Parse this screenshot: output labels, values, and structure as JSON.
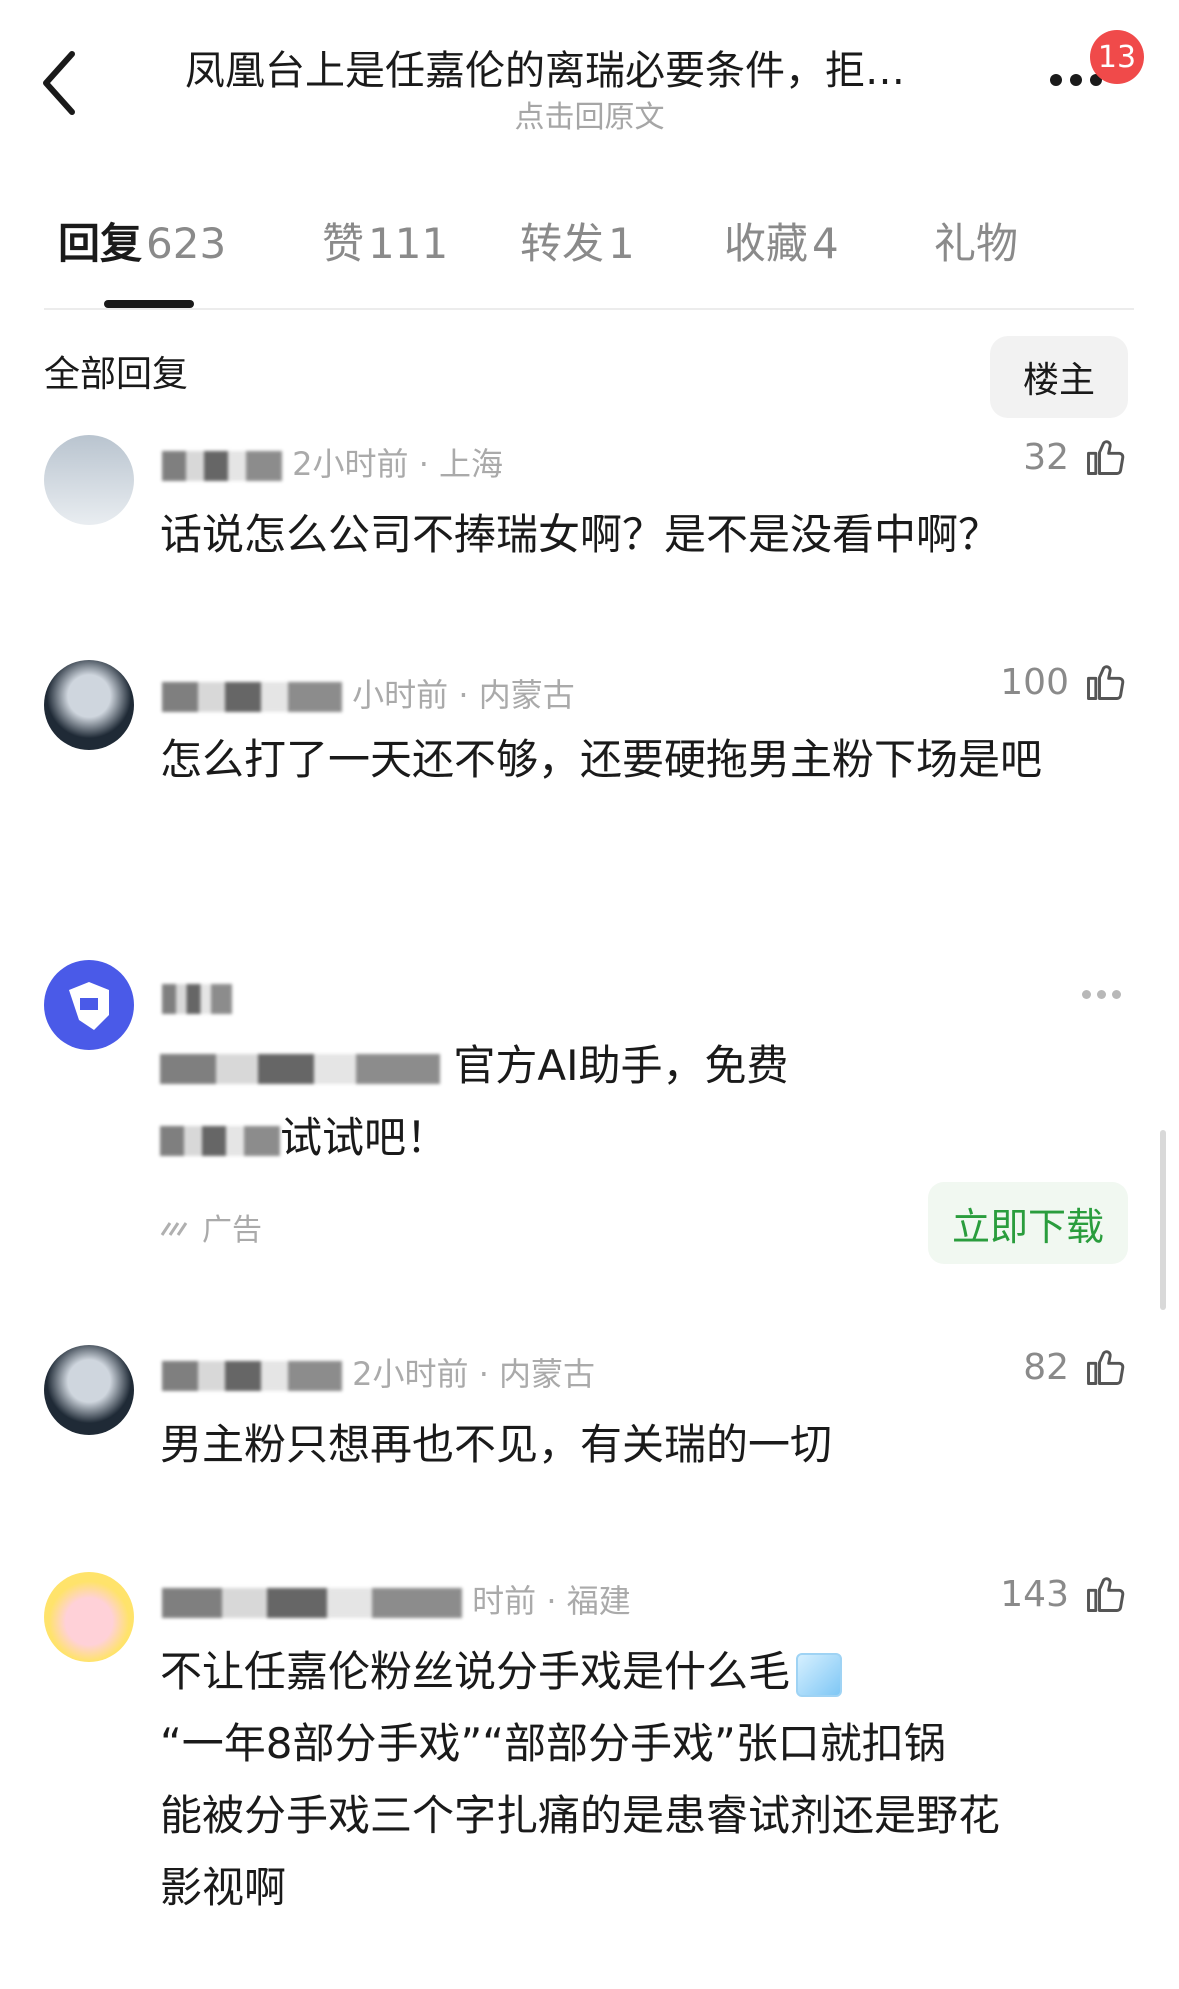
{
  "header": {
    "title": "凤凰台上是任嘉伦的离瑞必要条件，拒…",
    "subtitle": "点击回原文",
    "badge": "13"
  },
  "tabs": [
    {
      "label": "回复",
      "count": "623"
    },
    {
      "label": "赞",
      "count": "111"
    },
    {
      "label": "转发",
      "count": "1"
    },
    {
      "label": "收藏",
      "count": "4"
    },
    {
      "label": "礼物",
      "count": ""
    }
  ],
  "section": {
    "title": "全部回复",
    "filter_button": "楼主"
  },
  "comments": [
    {
      "meta": "2小时前 · 上海",
      "likes": "32",
      "text": "话说怎么公司不捧瑞女啊？是不是没看中啊？"
    },
    {
      "meta": "小时前 · 内蒙古",
      "likes": "100",
      "text": "怎么打了一天还不够，还要硬拖男主粉下场是吧"
    },
    {
      "meta": "2小时前 · 内蒙古",
      "likes": "82",
      "text": "男主粉只想再也不见，有关瑞的一切"
    },
    {
      "meta": "时前 · 福建",
      "likes": "143",
      "lines": [
        "不让任嘉伦粉丝说分手戏是什么毛",
        "“一年8部分手戏”“部部分手戏”张口就扣锅",
        "能被分手戏三个字扎痛的是患睿试剂还是野花",
        "影视啊"
      ]
    }
  ],
  "ad": {
    "text_line1": "官方AI助手，免费",
    "text_line2": "试试吧！",
    "label": "广告",
    "download": "立即下载"
  },
  "icons": {
    "back": "chevron-left-icon",
    "more": "more-dots-icon",
    "like": "thumbs-up-icon"
  },
  "colors": {
    "badge": "#f04a4a",
    "download_text": "#2a9d3d",
    "download_bg": "#f1f8f1"
  }
}
